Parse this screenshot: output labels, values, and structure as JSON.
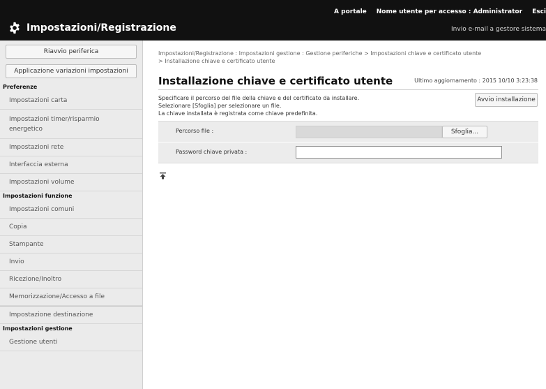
{
  "header": {
    "portal_link": "A portale",
    "user_label": "Nome utente per accesso :",
    "user_name": "Administrator",
    "logout_link": "Esci",
    "app_title": "Impostazioni/Registrazione",
    "mail_link": "Invio e-mail a gestore sistema",
    "app_icon": "gear-icon"
  },
  "sidebar": {
    "restart_button": "Riavvio periferica",
    "apply_button": "Applicazione variazioni impostazioni",
    "groups": [
      {
        "heading": "Preferenze",
        "items": [
          "Impostazioni carta",
          "Impostazioni timer/risparmio energetico",
          "Impostazioni rete",
          "Interfaccia esterna",
          "Impostazioni volume"
        ]
      },
      {
        "heading": "Impostazioni funzione",
        "items": [
          "Impostazioni comuni",
          "Copia",
          "Stampante",
          "Invio",
          "Ricezione/Inoltro",
          "Memorizzazione/Accesso a file"
        ]
      },
      {
        "heading": "",
        "items": [
          "Impostazione destinazione"
        ]
      },
      {
        "heading": "Impostazioni gestione",
        "items": [
          "Gestione utenti"
        ]
      }
    ]
  },
  "main": {
    "breadcrumb_line1": "Impostazioni/Registrazione : Impostazioni gestione : Gestione periferiche > Impostazioni chiave e certificato utente",
    "breadcrumb_line2": "> Installazione chiave e certificato utente",
    "title": "Installazione chiave e certificato utente",
    "last_updated": "Ultimo aggiornamento : 2015 10/10 3:23:38",
    "description": [
      "Specificare il percorso del file della chiave e del certificato da installare.",
      "Selezionare [Sfoglia] per selezionare un file.",
      "La chiave installata è registrata come chiave predefinita."
    ],
    "start_button": "Avvio installazione",
    "form": {
      "file_path_label": "Percorso file :",
      "file_path_value": "",
      "browse_button": "Sfoglia...",
      "private_key_password_label": "Password chiave privata :",
      "private_key_password_value": ""
    },
    "top_icon": "scroll-to-top-icon"
  },
  "colors": {
    "header_bg": "#111111",
    "sidebar_bg": "#ebebeb",
    "form_bg": "#ececec"
  }
}
